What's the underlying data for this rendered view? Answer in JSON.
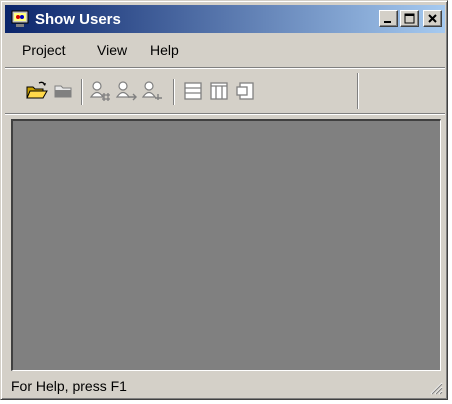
{
  "window": {
    "title": "Show Users"
  },
  "title_buttons": [
    "minimize-button",
    "maximize-button",
    "close-button"
  ],
  "menu": {
    "items": [
      "Project",
      "View",
      "Help"
    ]
  },
  "toolbar": {
    "groups": [
      [
        "open-folder-icon",
        "folder-icon"
      ],
      [
        "user-hash-icon",
        "user-arrow-icon",
        "user-add-icon"
      ],
      [
        "view-horizontal-icon",
        "view-columns-icon",
        "view-split-icon"
      ]
    ]
  },
  "status": {
    "text": "For Help, press F1"
  },
  "colors": {
    "titlebar_start": "#0a246a",
    "titlebar_end": "#a6caf0",
    "client_bg": "#808080",
    "chrome": "#d4d0c8"
  }
}
